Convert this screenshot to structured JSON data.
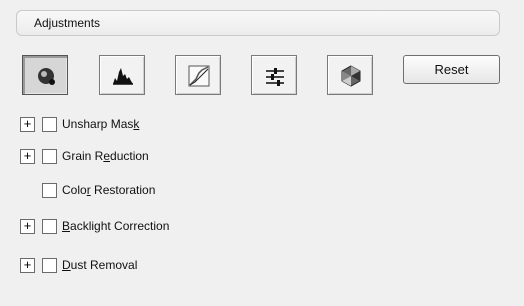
{
  "header": {
    "title": "Adjustments"
  },
  "toolbar": {
    "buttons": [
      {
        "icon": "unsharp-tone-icon",
        "pressed": true
      },
      {
        "icon": "histogram-icon",
        "pressed": false
      },
      {
        "icon": "tone-curve-icon",
        "pressed": false
      },
      {
        "icon": "sliders-icon",
        "pressed": false
      },
      {
        "icon": "color-palette-icon",
        "pressed": false
      }
    ],
    "reset_label": "Reset"
  },
  "options": [
    {
      "label_pre": "Unsharp Mas",
      "label_mnemonic": "k",
      "label_post": "",
      "expandable": true,
      "checked": false
    },
    {
      "label_pre": "Grain R",
      "label_mnemonic": "e",
      "label_post": "duction",
      "expandable": true,
      "checked": false
    },
    {
      "label_pre": "Colo",
      "label_mnemonic": "r",
      "label_post": " Restoration",
      "expandable": false,
      "checked": false
    },
    {
      "label_pre": "",
      "label_mnemonic": "B",
      "label_post": "acklight Correction",
      "expandable": true,
      "checked": false
    },
    {
      "label_pre": "",
      "label_mnemonic": "D",
      "label_post": "ust Removal",
      "expandable": true,
      "checked": false
    }
  ],
  "colors": {
    "background": "#f0f0f0",
    "border": "#6b6b6b"
  }
}
